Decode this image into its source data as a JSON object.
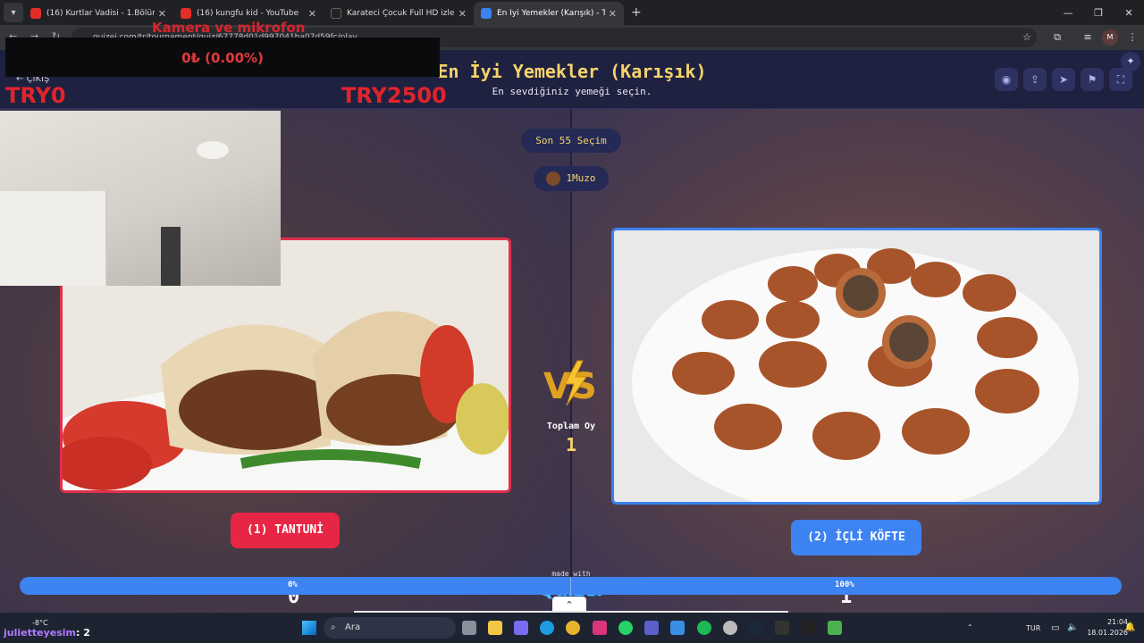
{
  "browser": {
    "tabs": [
      {
        "title": "(16) Kurtlar Vadisi - 1.Bölüm | Fi",
        "fav": "#e52d27"
      },
      {
        "title": "(16) kungfu kid - YouTube",
        "fav": "#e52d27"
      },
      {
        "title": "Karateci Çocuk Full HD izle",
        "fav": "#222222"
      },
      {
        "title": "En İyi Yemekler (Karışık) - Tier L",
        "fav": "#3c82f0"
      }
    ],
    "url": "quizei.com/tr/tournament/quiz/67778d01d997041ba07d59fc/play",
    "profile_initial": "M"
  },
  "quiz": {
    "title": "En İyi Yemekler (Karışık)",
    "subtitle": "En sevdiğiniz yemeği seçin.",
    "exit_label": "ÇIKIŞ",
    "round_pill": "Son 55 Seçim",
    "user_pill": "1Muzo",
    "left": {
      "label": "(1) TANTUNİ",
      "score": "0",
      "percent": "0%"
    },
    "right": {
      "label": "(2) İÇLİ KÖFTE",
      "score": "1",
      "percent": "100%"
    },
    "progress_right_fraction": 1.0,
    "total_label": "Toplam Oy",
    "total_value": "1",
    "made_with": "made with",
    "brand": "Quizei",
    "colors": {
      "left": "#e62644",
      "right": "#3d83f2",
      "accent": "#f5d36b"
    }
  },
  "overlay": {
    "red_title": "Kamera ve mikrofon",
    "money": "0₺ (0.00%)",
    "try_left": "TRY0",
    "try_right": "TRY2500"
  },
  "chat": [
    {
      "user": "julietteyesim",
      "count": ": 2"
    },
    {
      "user": "julietteyesim",
      "count": ": 2"
    }
  ],
  "taskbar": {
    "search_label": "Ara",
    "temp": "-8°C",
    "lang": "TUR",
    "time": "21:04",
    "date": "18.01.2026"
  }
}
